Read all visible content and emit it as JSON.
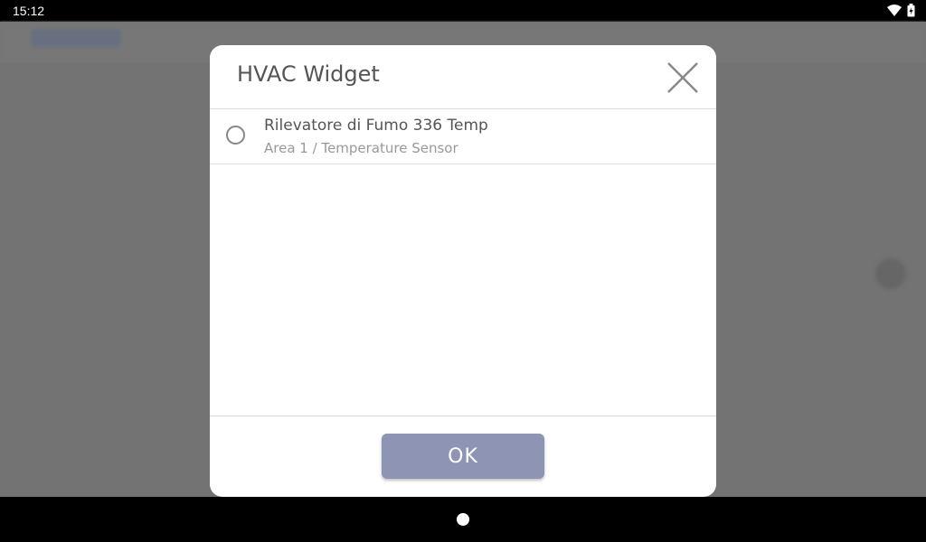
{
  "status_bar": {
    "time": "15:12",
    "icons": [
      "wifi-icon",
      "battery-icon"
    ]
  },
  "dialog": {
    "title": "HVAC Widget",
    "close_icon": "close-icon",
    "items": [
      {
        "title": "Rilevatore di Fumo 336 Temp",
        "subtitle": "Area 1 / Temperature Sensor",
        "selected": false
      }
    ],
    "ok_label": "OK"
  },
  "colors": {
    "ok_button": "#8e94b4",
    "dim_background": "#737373",
    "dialog_bg": "#ffffff"
  }
}
